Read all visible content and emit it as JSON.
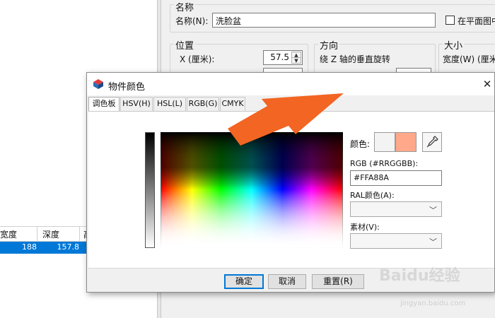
{
  "background": {
    "name_group": {
      "title": "名称",
      "name_label": "名称(N):",
      "name_value": "洗脸盆",
      "plane_checkbox_label": "在平面图中"
    },
    "position_group": {
      "title": "位置",
      "x_label": "X (厘米):",
      "x_value": "57.5"
    },
    "direction_group": {
      "title": "方向",
      "rotation_label": "绕 Z 轴的垂直旋转"
    },
    "size_group": {
      "title": "大小",
      "width_label": "宽度(W) (厘米"
    },
    "table": {
      "headers": [
        "宽度",
        "深度",
        "高"
      ],
      "row": [
        "188",
        "157.8"
      ]
    }
  },
  "dialog": {
    "title": "物件颜色",
    "tabs": [
      "调色板",
      "HSV(H)",
      "HSL(L)",
      "RGB(G)",
      "CMYK"
    ],
    "active_tab": 0,
    "color_label": "颜色:",
    "rgb_label": "RGB (#RRGGBB):",
    "rgb_value": "#FFA88A",
    "ral_label": "RAL颜色(A):",
    "material_label": "素材(V):",
    "buttons": {
      "ok": "确定",
      "cancel": "取消",
      "reset": "重置(R)"
    },
    "colors": {
      "selected": "#FFA88A",
      "previous": "#F3F3F3",
      "annotation_arrow": "#F26522"
    },
    "icons": {
      "close": "close-icon",
      "eyedropper": "eyedropper-icon",
      "dropdown": "chevron-down-icon"
    }
  },
  "watermark": {
    "logo": "Baidu经验",
    "url": "jingyan.baidu.com"
  }
}
